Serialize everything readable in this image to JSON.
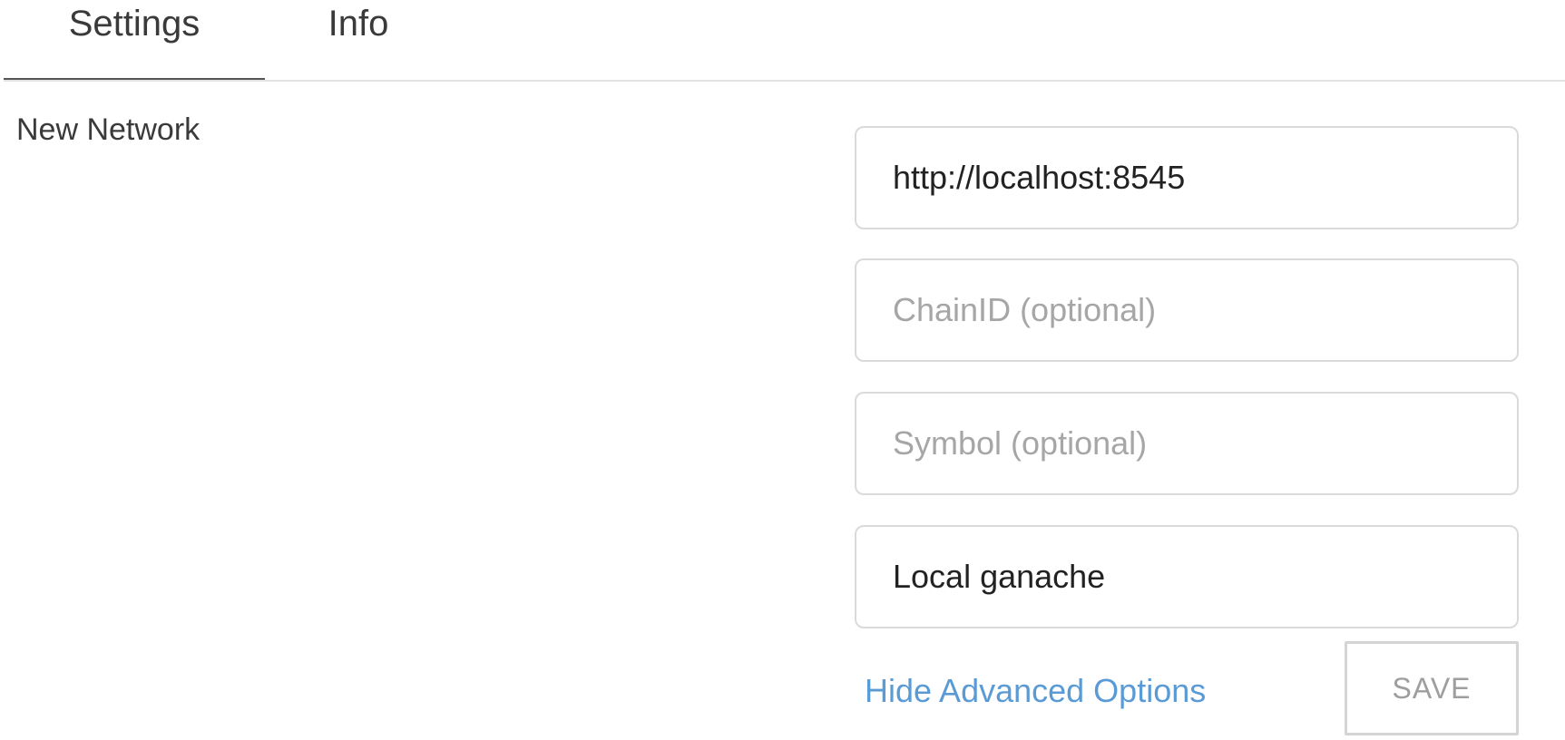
{
  "tabs": [
    {
      "label": "Settings",
      "active": true
    },
    {
      "label": "Info",
      "active": false
    }
  ],
  "network_form": {
    "title": "New Network",
    "rpc_url": {
      "value": "http://localhost:8545",
      "placeholder": ""
    },
    "chain_id": {
      "value": "",
      "placeholder": "ChainID (optional)"
    },
    "symbol": {
      "value": "",
      "placeholder": "Symbol (optional)"
    },
    "nickname": {
      "value": "Local ganache",
      "placeholder": ""
    },
    "advanced_link_label": "Hide Advanced Options",
    "save_label": "SAVE"
  },
  "colors": {
    "link": "#5b9bd5",
    "border": "#dadada",
    "text": "#333333",
    "placeholder": "#a6a6a6"
  }
}
